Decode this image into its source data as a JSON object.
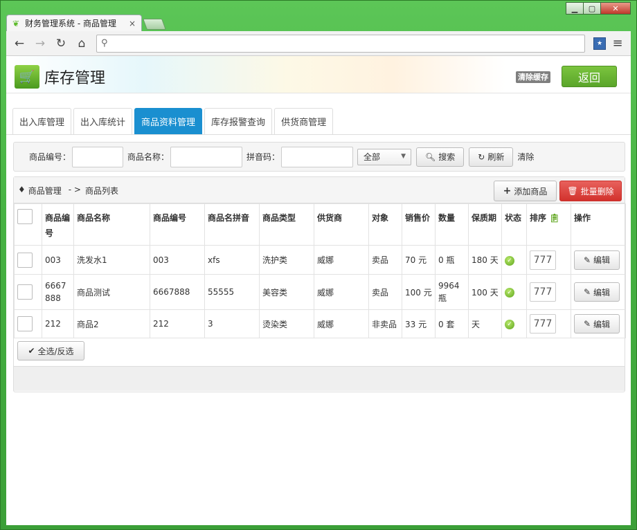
{
  "browser": {
    "tab_title": "财务管理系统 - 商品管理",
    "tab_close": "×",
    "address": ""
  },
  "header": {
    "title": "库存管理",
    "clear_cache": "清除缓存",
    "back": "返回"
  },
  "tabs": [
    {
      "label": "出入库管理",
      "active": false
    },
    {
      "label": "出入库统计",
      "active": false
    },
    {
      "label": "商品资料管理",
      "active": true
    },
    {
      "label": "库存报警查询",
      "active": false
    },
    {
      "label": "供货商管理",
      "active": false
    }
  ],
  "search": {
    "code_label": "商品编号：",
    "name_label": "商品名称：",
    "pinyin_label": "拼音码：",
    "select_value": "全部",
    "search_btn": "搜索",
    "refresh_btn": "刷新",
    "clear_link": "清除"
  },
  "list": {
    "crumb_root": "商品管理",
    "crumb_sep": "- >",
    "crumb_current": "商品列表",
    "add_btn": "添加商品",
    "batch_delete_btn": "批量删除",
    "columns": {
      "code": "商品编号",
      "name": "商品名称",
      "code2": "商品编号",
      "pinyin": "商品名拼音",
      "type": "商品类型",
      "supplier": "供货商",
      "target": "对象",
      "price": "销售价",
      "qty": "数量",
      "shelf": "保质期",
      "status": "状态",
      "sort": "排序",
      "action": "操作"
    },
    "rows": [
      {
        "code": "003",
        "name": "洗发水1",
        "code2": "003",
        "pinyin": "xfs",
        "type": "洗护类",
        "supplier": "威娜",
        "target": "卖品",
        "price": "70 元",
        "qty": "0 瓶",
        "shelf": "180 天",
        "sort": "777",
        "edit": "编辑"
      },
      {
        "code": "6667888",
        "name": "商品测试",
        "code2": "6667888",
        "pinyin": "55555",
        "type": "美容类",
        "supplier": "威娜",
        "target": "卖品",
        "price": "100 元",
        "qty": "9964 瓶",
        "shelf": "100 天",
        "sort": "777",
        "edit": "编辑"
      },
      {
        "code": "212",
        "name": "商品2",
        "code2": "212",
        "pinyin": "3",
        "type": "烫染类",
        "supplier": "威娜",
        "target": "非卖品",
        "price": "33 元",
        "qty": "0 套",
        "shelf": "天",
        "sort": "777",
        "edit": "编辑"
      }
    ],
    "select_all_btn": "全选/反选"
  }
}
